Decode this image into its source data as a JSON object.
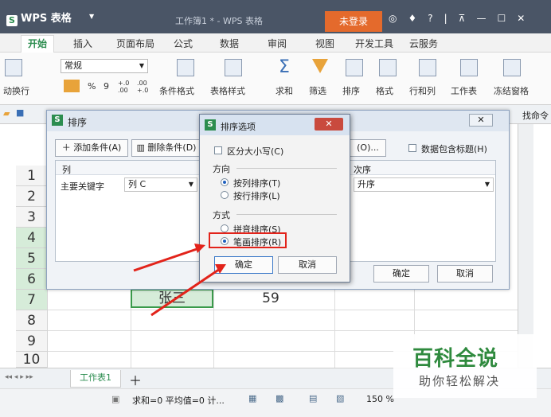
{
  "app": {
    "name": "WPS 表格",
    "doc_title": "工作簿1 * - WPS 表格",
    "login": "未登录",
    "title_icons": [
      "?"
    ]
  },
  "tabs": [
    "开始",
    "插入",
    "页面布局",
    "公式",
    "数据",
    "审阅",
    "视图",
    "开发工具",
    "云服务"
  ],
  "ribbon": {
    "wrap": "动换行",
    "format_select": "常规",
    "percent": "%",
    "comma": "9",
    "decimal_inc": "+.0 .00",
    "decimal_dec": ".00 +.0",
    "cond_format": "条件格式",
    "table_style": "表格样式",
    "sum": "求和",
    "filter": "筛选",
    "sort": "排序",
    "format": "格式",
    "rowcol": "行和列",
    "worksheet": "工作表",
    "freeze": "冻结窗格"
  },
  "toolbar2": {
    "right_hint": "找命令"
  },
  "row_numbers": [
    "1",
    "2",
    "3",
    "4",
    "5",
    "6",
    "7",
    "8",
    "9",
    "10"
  ],
  "cells": {
    "name": "张三",
    "value": "59"
  },
  "sort_dialog": {
    "title": "排序",
    "add_condition": "添加条件(A)",
    "delete_condition": "删除条件(D)",
    "options_button": "(O)...",
    "has_header": "数据包含标题(H)",
    "col_header": "列",
    "order_header": "次序",
    "key_label": "主要关键字",
    "key_value": "列 C",
    "order_value": "升序",
    "ok": "确定",
    "cancel": "取消"
  },
  "options_dialog": {
    "title": "排序选项",
    "case_sensitive": "区分大小写(C)",
    "direction_label": "方向",
    "by_column": "按列排序(T)",
    "by_row": "按行排序(L)",
    "method_label": "方式",
    "pinyin": "拼音排序(S)",
    "stroke": "笔画排序(R)",
    "ok": "确定",
    "cancel": "取消"
  },
  "sheet_tab": "工作表1",
  "status": {
    "text": "求和=0 平均值=0 计...",
    "zoom": "150 %"
  },
  "watermark": {
    "title": "百科全说",
    "subtitle": "助你轻松解决"
  },
  "colors": {
    "accent": "#2c8d4f",
    "login": "#e46a2c",
    "highlight": "#e2231a"
  }
}
